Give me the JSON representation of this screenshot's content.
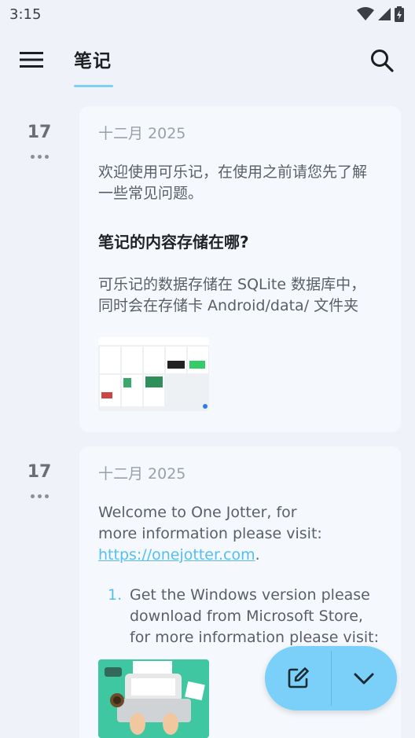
{
  "status_bar": {
    "time": "3:15"
  },
  "header": {
    "title": "笔记"
  },
  "notes": [
    {
      "day": "17",
      "date": "十二月 2025",
      "intro": "欢迎使用可乐记，在使用之前请您先了解一些常见问题。",
      "heading": "笔记的内容存储在哪?",
      "line1": "可乐记的数据存储在 SQLite 数据库中，",
      "line2": "同时会在存储卡 Android/data/ 文件夹"
    },
    {
      "day": "17",
      "date": "十二月 2025",
      "intro_line1": "Welcome to One Jotter, for",
      "intro_line2": "more information please visit:",
      "link": "https://onejotter.com",
      "link_suffix": ".",
      "list_num": "1.",
      "list_line1": "Get the Windows version please",
      "list_line2": "download from Microsoft Store,",
      "list_line3": "for more information please visit:"
    }
  ],
  "colors": {
    "background": "#eff2f8",
    "card": "#f5f9fe",
    "accent": "#54bef0",
    "fab": "#7ad0f8"
  },
  "icons": {
    "menu": "hamburger-menu-icon",
    "search": "search-icon",
    "more": "more-dots-icon",
    "fab_left": "edit-note-icon",
    "fab_right": "chevron-down-icon"
  }
}
